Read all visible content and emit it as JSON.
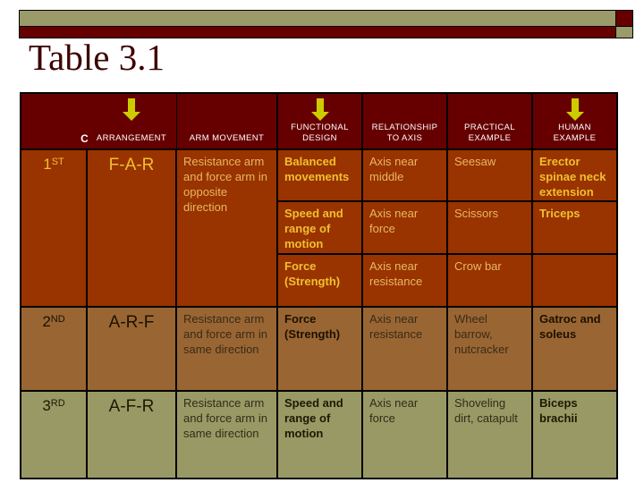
{
  "title": "Table 3.1",
  "colors": {
    "banner_olive": "#9a9a6a",
    "banner_maroon": "#660000",
    "header_bg": "#660000",
    "row1_bg": "#993300",
    "row2_bg": "#996633",
    "row3_bg": "#999966",
    "row1_text": "#f0c030",
    "arrow": "#cccc00"
  },
  "headers": [
    {
      "label": "CLASS",
      "arrow": true
    },
    {
      "label": "ARRANGEMENT",
      "arrow": true
    },
    {
      "label": "ARM MOVEMENT",
      "arrow": false
    },
    {
      "label_line1": "FUNCTIONAL",
      "label_line2": "DESIGN",
      "arrow": true
    },
    {
      "label_line1": "RELATIONSHIP",
      "label_line2": "TO AXIS",
      "arrow": false
    },
    {
      "label_line1": "PRACTICAL",
      "label_line2": "EXAMPLE",
      "arrow": false
    },
    {
      "label_line1": "HUMAN",
      "label_line2": "EXAMPLE",
      "arrow": true
    }
  ],
  "icons": {
    "header_arrow": "down-arrow-icon"
  },
  "rows": [
    {
      "class_num": "1",
      "class_suffix": "ST",
      "arrangement": "F-A-R",
      "arm_movement": "Resistance arm and force arm in opposite direction",
      "subrows": [
        {
          "functional_design": "Balanced movements",
          "relationship": "Axis near middle",
          "practical": "Seesaw",
          "human": "Erector spinae neck extension"
        },
        {
          "functional_design": "Speed and range of motion",
          "relationship": "Axis near force",
          "practical": "Scissors",
          "human": "Triceps"
        },
        {
          "functional_design": "Force (Strength)",
          "relationship": "Axis near resistance",
          "practical": "Crow bar",
          "human": ""
        }
      ]
    },
    {
      "class_num": "2",
      "class_suffix": "ND",
      "arrangement": "A-R-F",
      "arm_movement": "Resistance arm and force arm in same direction",
      "subrows": [
        {
          "functional_design": "Force (Strength)",
          "relationship": "Axis near resistance",
          "practical": "Wheel barrow, nutcracker",
          "human": "Gatroc and soleus"
        }
      ]
    },
    {
      "class_num": "3",
      "class_suffix": "RD",
      "arrangement": "A-F-R",
      "arm_movement": "Resistance arm and force arm in same direction",
      "subrows": [
        {
          "functional_design": "Speed and range of motion",
          "relationship": "Axis near force",
          "practical": "Shoveling dirt, catapult",
          "human": "Biceps brachii"
        }
      ]
    }
  ]
}
